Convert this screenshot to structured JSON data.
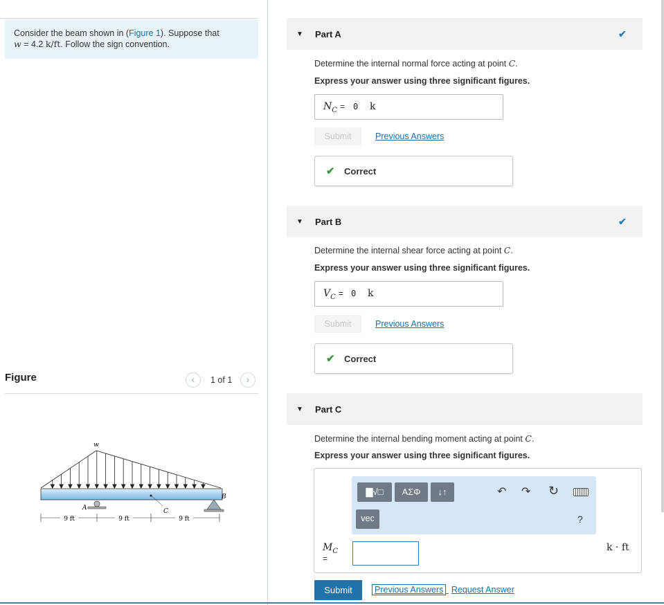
{
  "intro": {
    "prefix": "Consider the beam shown in (",
    "figure_link": "Figure 1",
    "mid": "). Suppose that",
    "w_var": "w",
    "w_eq": " = 4.2 ",
    "w_unit": "k/ft",
    "suffix": ". Follow the sign convention."
  },
  "figure": {
    "label": "Figure",
    "pager": "1 of 1",
    "beam": {
      "load_label": "w",
      "point_a": "A",
      "point_b": "B",
      "point_c": "C",
      "dims": [
        "9 ft",
        "9 ft",
        "9 ft"
      ]
    }
  },
  "parts": [
    {
      "title": "Part A",
      "question_prefix": "Determine the internal normal force acting at point ",
      "point": "C",
      "instruction": "Express your answer using three significant figures.",
      "lhs_var": "N",
      "lhs_sub": "C",
      "eq": "=",
      "value": "0",
      "unit": "k",
      "submit": "Submit",
      "prev": "Previous Answers",
      "status": "Correct"
    },
    {
      "title": "Part B",
      "question_prefix": "Determine the internal shear force acting at point ",
      "point": "C",
      "instruction": "Express your answer using three significant figures.",
      "lhs_var": "V",
      "lhs_sub": "C",
      "eq": "=",
      "value": "0",
      "unit": "k",
      "submit": "Submit",
      "prev": "Previous Answers",
      "status": "Correct"
    },
    {
      "title": "Part C",
      "question_prefix": "Determine the internal bending moment acting at point ",
      "point": "C",
      "instruction": "Express your answer using three significant figures.",
      "lhs_var": "M",
      "lhs_sub": "C",
      "eq": "=",
      "unit": "k · ft",
      "toolbar": {
        "templates": "▇√□",
        "greek": "ΑΣΦ",
        "arrows": "↓↑",
        "vec": "vec",
        "help": "?"
      },
      "submit": "Submit",
      "prev": "Previous Answers",
      "request": "Request Answer"
    }
  ],
  "colors": {
    "accent": "#1f73a8",
    "correct": "#3a9a3a",
    "header_bg": "#f2f2f2",
    "intro_bg": "#e9f3fa"
  }
}
